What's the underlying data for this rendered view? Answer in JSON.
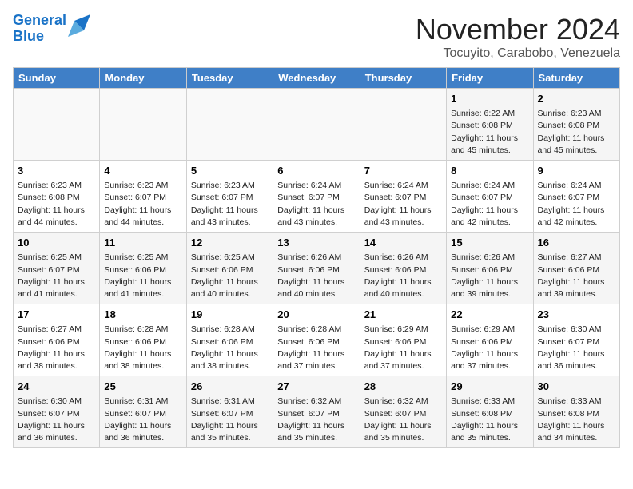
{
  "header": {
    "logo_line1": "General",
    "logo_line2": "Blue",
    "month_title": "November 2024",
    "location": "Tocuyito, Carabobo, Venezuela"
  },
  "days_of_week": [
    "Sunday",
    "Monday",
    "Tuesday",
    "Wednesday",
    "Thursday",
    "Friday",
    "Saturday"
  ],
  "weeks": [
    [
      {
        "day": "",
        "info": ""
      },
      {
        "day": "",
        "info": ""
      },
      {
        "day": "",
        "info": ""
      },
      {
        "day": "",
        "info": ""
      },
      {
        "day": "",
        "info": ""
      },
      {
        "day": "1",
        "info": "Sunrise: 6:22 AM\nSunset: 6:08 PM\nDaylight: 11 hours and 45 minutes."
      },
      {
        "day": "2",
        "info": "Sunrise: 6:23 AM\nSunset: 6:08 PM\nDaylight: 11 hours and 45 minutes."
      }
    ],
    [
      {
        "day": "3",
        "info": "Sunrise: 6:23 AM\nSunset: 6:08 PM\nDaylight: 11 hours and 44 minutes."
      },
      {
        "day": "4",
        "info": "Sunrise: 6:23 AM\nSunset: 6:07 PM\nDaylight: 11 hours and 44 minutes."
      },
      {
        "day": "5",
        "info": "Sunrise: 6:23 AM\nSunset: 6:07 PM\nDaylight: 11 hours and 43 minutes."
      },
      {
        "day": "6",
        "info": "Sunrise: 6:24 AM\nSunset: 6:07 PM\nDaylight: 11 hours and 43 minutes."
      },
      {
        "day": "7",
        "info": "Sunrise: 6:24 AM\nSunset: 6:07 PM\nDaylight: 11 hours and 43 minutes."
      },
      {
        "day": "8",
        "info": "Sunrise: 6:24 AM\nSunset: 6:07 PM\nDaylight: 11 hours and 42 minutes."
      },
      {
        "day": "9",
        "info": "Sunrise: 6:24 AM\nSunset: 6:07 PM\nDaylight: 11 hours and 42 minutes."
      }
    ],
    [
      {
        "day": "10",
        "info": "Sunrise: 6:25 AM\nSunset: 6:07 PM\nDaylight: 11 hours and 41 minutes."
      },
      {
        "day": "11",
        "info": "Sunrise: 6:25 AM\nSunset: 6:06 PM\nDaylight: 11 hours and 41 minutes."
      },
      {
        "day": "12",
        "info": "Sunrise: 6:25 AM\nSunset: 6:06 PM\nDaylight: 11 hours and 40 minutes."
      },
      {
        "day": "13",
        "info": "Sunrise: 6:26 AM\nSunset: 6:06 PM\nDaylight: 11 hours and 40 minutes."
      },
      {
        "day": "14",
        "info": "Sunrise: 6:26 AM\nSunset: 6:06 PM\nDaylight: 11 hours and 40 minutes."
      },
      {
        "day": "15",
        "info": "Sunrise: 6:26 AM\nSunset: 6:06 PM\nDaylight: 11 hours and 39 minutes."
      },
      {
        "day": "16",
        "info": "Sunrise: 6:27 AM\nSunset: 6:06 PM\nDaylight: 11 hours and 39 minutes."
      }
    ],
    [
      {
        "day": "17",
        "info": "Sunrise: 6:27 AM\nSunset: 6:06 PM\nDaylight: 11 hours and 38 minutes."
      },
      {
        "day": "18",
        "info": "Sunrise: 6:28 AM\nSunset: 6:06 PM\nDaylight: 11 hours and 38 minutes."
      },
      {
        "day": "19",
        "info": "Sunrise: 6:28 AM\nSunset: 6:06 PM\nDaylight: 11 hours and 38 minutes."
      },
      {
        "day": "20",
        "info": "Sunrise: 6:28 AM\nSunset: 6:06 PM\nDaylight: 11 hours and 37 minutes."
      },
      {
        "day": "21",
        "info": "Sunrise: 6:29 AM\nSunset: 6:06 PM\nDaylight: 11 hours and 37 minutes."
      },
      {
        "day": "22",
        "info": "Sunrise: 6:29 AM\nSunset: 6:06 PM\nDaylight: 11 hours and 37 minutes."
      },
      {
        "day": "23",
        "info": "Sunrise: 6:30 AM\nSunset: 6:07 PM\nDaylight: 11 hours and 36 minutes."
      }
    ],
    [
      {
        "day": "24",
        "info": "Sunrise: 6:30 AM\nSunset: 6:07 PM\nDaylight: 11 hours and 36 minutes."
      },
      {
        "day": "25",
        "info": "Sunrise: 6:31 AM\nSunset: 6:07 PM\nDaylight: 11 hours and 36 minutes."
      },
      {
        "day": "26",
        "info": "Sunrise: 6:31 AM\nSunset: 6:07 PM\nDaylight: 11 hours and 35 minutes."
      },
      {
        "day": "27",
        "info": "Sunrise: 6:32 AM\nSunset: 6:07 PM\nDaylight: 11 hours and 35 minutes."
      },
      {
        "day": "28",
        "info": "Sunrise: 6:32 AM\nSunset: 6:07 PM\nDaylight: 11 hours and 35 minutes."
      },
      {
        "day": "29",
        "info": "Sunrise: 6:33 AM\nSunset: 6:08 PM\nDaylight: 11 hours and 35 minutes."
      },
      {
        "day": "30",
        "info": "Sunrise: 6:33 AM\nSunset: 6:08 PM\nDaylight: 11 hours and 34 minutes."
      }
    ]
  ]
}
